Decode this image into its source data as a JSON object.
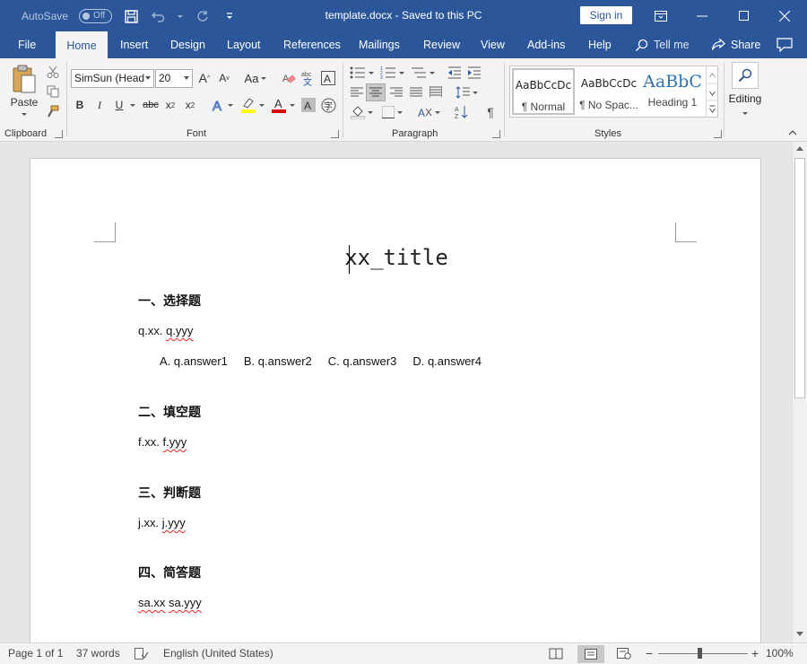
{
  "titlebar": {
    "autosave_label": "AutoSave",
    "autosave_state": "Off",
    "document_title": "template.docx  -  Saved to this PC",
    "signin_label": "Sign in"
  },
  "tabs": [
    {
      "label": "File"
    },
    {
      "label": "Home"
    },
    {
      "label": "Insert"
    },
    {
      "label": "Design"
    },
    {
      "label": "Layout"
    },
    {
      "label": "References"
    },
    {
      "label": "Mailings"
    },
    {
      "label": "Review"
    },
    {
      "label": "View"
    },
    {
      "label": "Add-ins"
    },
    {
      "label": "Help"
    }
  ],
  "active_tab": "Home",
  "tell_me": "Tell me",
  "share_label": "Share",
  "ribbon": {
    "clipboard": {
      "paste_label": "Paste",
      "group_label": "Clipboard"
    },
    "font": {
      "font_name": "SimSun (Head",
      "font_size": "20",
      "group_label": "Font"
    },
    "paragraph": {
      "group_label": "Paragraph"
    },
    "styles": {
      "group_label": "Styles",
      "items": [
        {
          "sample": "AaBbCcDc",
          "name": "¶ Normal"
        },
        {
          "sample": "AaBbCcDc",
          "name": "¶ No Spac..."
        },
        {
          "sample": "AaBbC",
          "name": "Heading 1"
        }
      ]
    },
    "editing_label": "Editing"
  },
  "document": {
    "title": "xx_title",
    "sections": [
      {
        "heading": "一、选择题",
        "question_prefix": "q.xx.",
        "question_text": "q.yyy"
      },
      {
        "heading": "二、填空题",
        "question_prefix": "f.xx.",
        "question_text": "f.yyy"
      },
      {
        "heading": "三、判断题",
        "question_prefix": "j.xx.",
        "question_text": "j.yyy"
      },
      {
        "heading": "四、简答题",
        "question_prefix": "sa.xx",
        "question_text": "sa.yyy"
      }
    ],
    "choices": [
      "A. q.answer1",
      "B. q.answer2",
      "C. q.answer3",
      "D. q.answer4"
    ]
  },
  "statusbar": {
    "page": "Page 1 of 1",
    "words": "37 words",
    "language": "English (United States)",
    "zoom": "100%"
  },
  "colors": {
    "accent": "#2b579a",
    "ribbon_bg": "#f3f3f3",
    "doc_bg": "#e6e6e6"
  }
}
